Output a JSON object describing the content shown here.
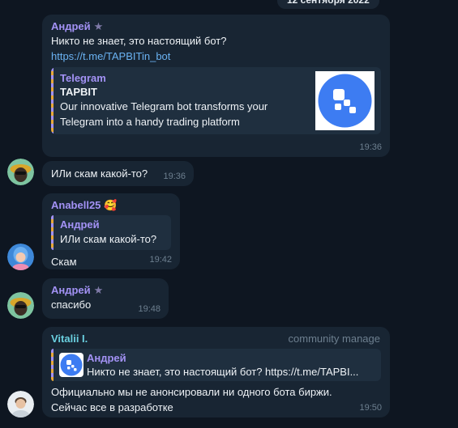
{
  "date_pill": "12 сентября 2022",
  "messages": [
    {
      "author": "Андрей",
      "text": "Никто не знает,  это настоящий бот?",
      "link": "https://t.me/TAPBITin_bot",
      "preview": {
        "site": "Telegram",
        "title": "TAPBIT",
        "description_1": "Our innovative Telegram bot transforms your",
        "description_2": "Telegram into a handy trading platform"
      },
      "time": "19:36"
    },
    {
      "text": "ИЛи скам какой-то?",
      "time": "19:36"
    },
    {
      "author": "Anabell25",
      "author_emoji": "🥰",
      "reply": {
        "author": "Андрей",
        "text": "ИЛи скам какой-то?"
      },
      "text": "Скам",
      "time": "19:42"
    },
    {
      "author": "Андрей",
      "text": "спасибо",
      "time": "19:48"
    },
    {
      "author": "Vitalii I.",
      "role": "community manage",
      "reply": {
        "author": "Андрей",
        "text": "Никто не знает,  это настоящий бот? https://t.me/TAPBI..."
      },
      "text_1": "Официально мы не анонсировали ни одного бота биржи.",
      "text_2": "Сейчас все в разработке",
      "time": "19:50"
    }
  ],
  "icons": {
    "star": "star-icon",
    "tapbit_logo": "tapbit-logo-icon"
  },
  "colors": {
    "background": "#0e1621",
    "bubble": "#182533",
    "accent_name": "#a392f5",
    "link": "#6ab2f2",
    "brand_blue": "#3d7cf2"
  }
}
